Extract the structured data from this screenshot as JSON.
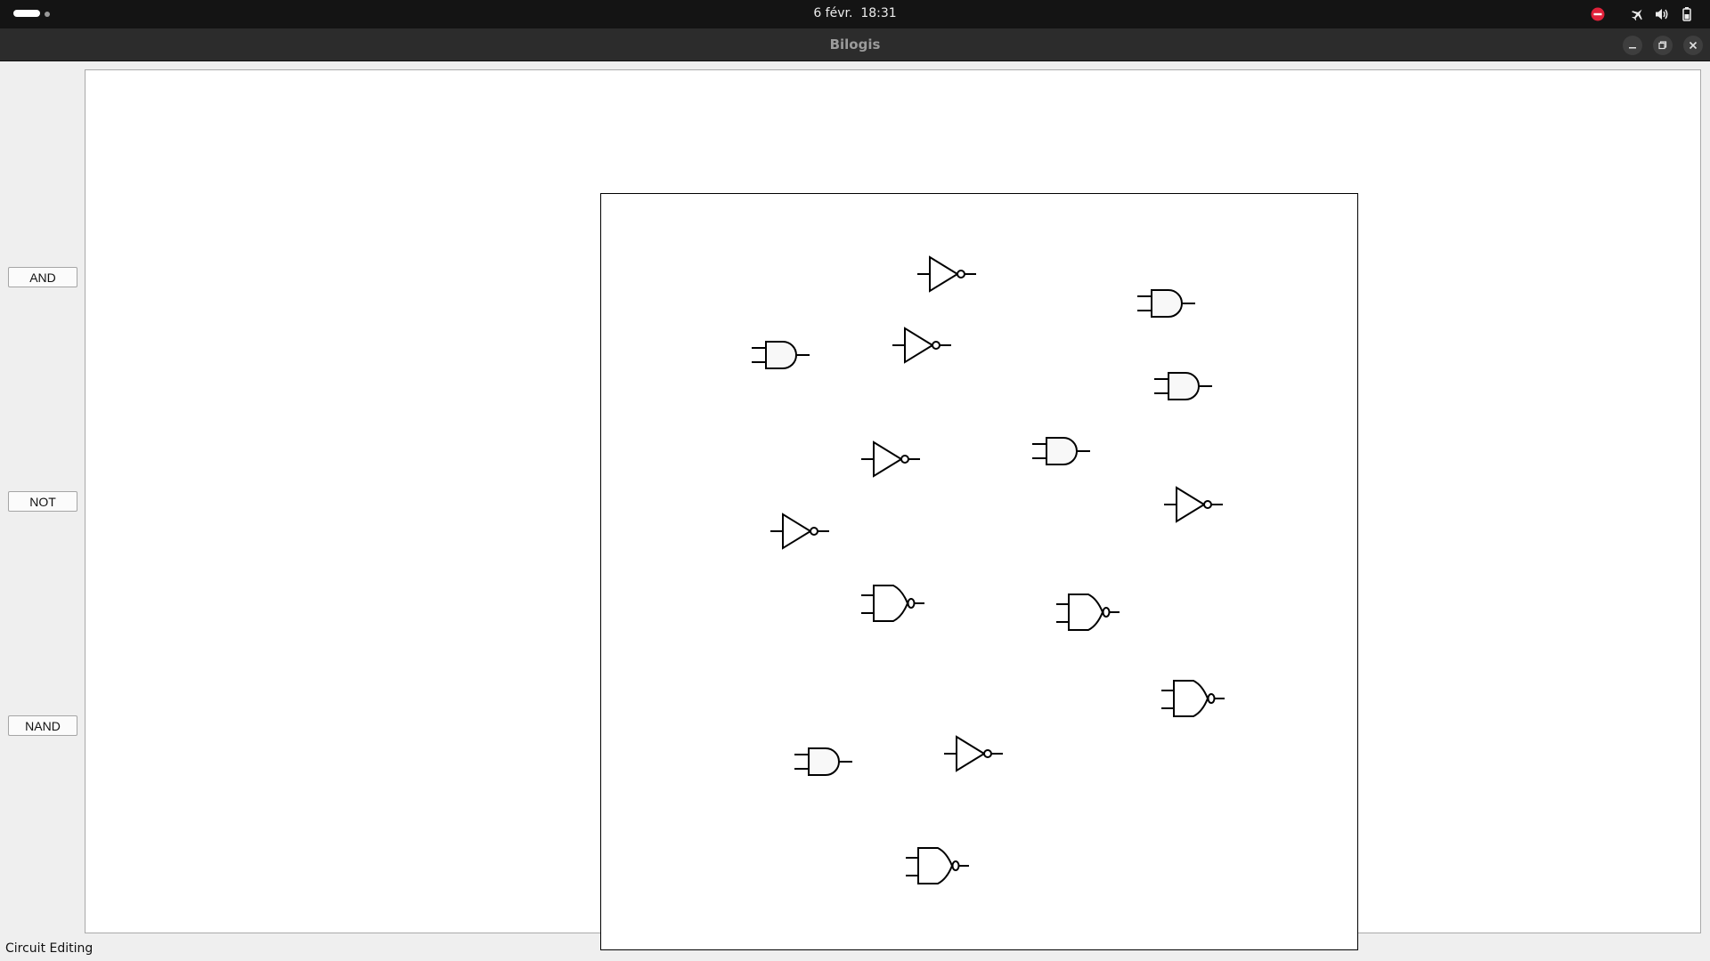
{
  "system_bar": {
    "date": "6 févr.",
    "time": "18:31",
    "indicators": [
      "do-not-disturb-icon",
      "airplane-mode-icon",
      "volume-icon",
      "battery-icon"
    ]
  },
  "window": {
    "title": "Bilogis",
    "controls": [
      "minimize-icon",
      "restore-icon",
      "close-icon"
    ]
  },
  "toolbox": {
    "buttons": [
      {
        "label": "AND"
      },
      {
        "label": "NOT"
      },
      {
        "label": "NAND"
      }
    ]
  },
  "circuit": {
    "gates": [
      {
        "type": "NOT"
      },
      {
        "type": "AND"
      },
      {
        "type": "AND"
      },
      {
        "type": "NOT"
      },
      {
        "type": "AND"
      },
      {
        "type": "NOT"
      },
      {
        "type": "AND"
      },
      {
        "type": "NOT"
      },
      {
        "type": "NOT"
      },
      {
        "type": "NAND"
      },
      {
        "type": "NAND"
      },
      {
        "type": "NAND"
      },
      {
        "type": "AND"
      },
      {
        "type": "NOT"
      },
      {
        "type": "NAND"
      }
    ]
  },
  "status_bar": {
    "text": "Circuit Editing"
  },
  "colors": {
    "top_bar": "#141414",
    "title_bar": "#2c2c2c",
    "canvas": "#ffffff",
    "gate_stroke": "#000000",
    "dnd_indicator": "#e0213a"
  }
}
